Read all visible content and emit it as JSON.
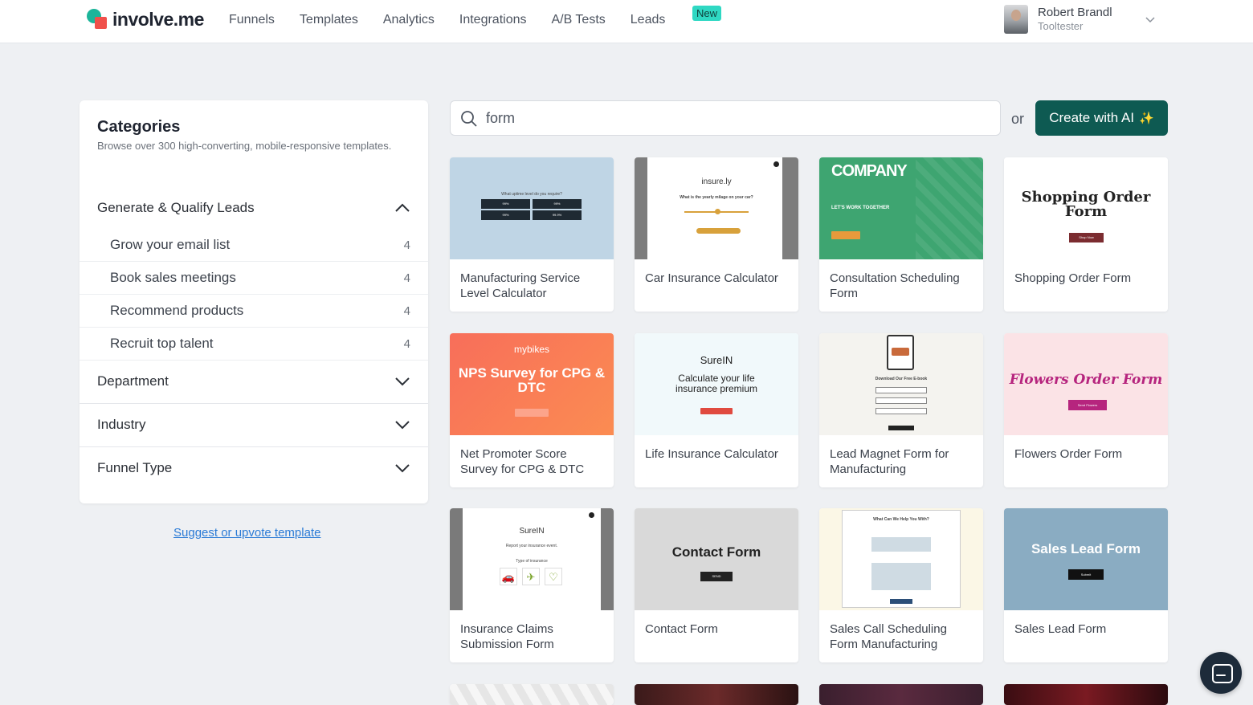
{
  "app": {
    "logo_text": "involve.me",
    "nav": [
      "Funnels",
      "Templates",
      "Analytics",
      "Integrations",
      "A/B Tests",
      "Leads"
    ],
    "new_badge": "New",
    "user": {
      "name": "Robert Brandl",
      "org": "Tooltester"
    }
  },
  "sidebar": {
    "title": "Categories",
    "description": "Browse over 300 high-converting, mobile-responsive templates.",
    "expanded_section": "Generate & Qualify Leads",
    "items": [
      {
        "label": "Grow your email list",
        "count": "4"
      },
      {
        "label": "Book sales meetings",
        "count": "4"
      },
      {
        "label": "Recommend products",
        "count": "4"
      },
      {
        "label": "Recruit top talent",
        "count": "4"
      }
    ],
    "collapsed_sections": [
      "Department",
      "Industry",
      "Funnel Type"
    ],
    "suggest_link": "Suggest or upvote template"
  },
  "search": {
    "value": "form",
    "or": "or",
    "ai_button": "Create with AI",
    "ai_sparkle": "✨"
  },
  "templates": [
    {
      "title": "Manufacturing Service Level Calculator",
      "thumb_text": "What uptime level do you require?",
      "thumb_buttons": [
        "99%",
        "99%",
        "99%",
        "99.9%"
      ]
    },
    {
      "title": "Car Insurance Calculator",
      "thumb_logo": "insure.ly",
      "thumb_text": "What is the yearly milage on your car?"
    },
    {
      "title": "Consultation Scheduling Form",
      "thumb_logo": "COMPANY",
      "thumb_text": "LET'S WORK TOGETHER"
    },
    {
      "title": "Shopping Order Form",
      "thumb_title": "Shopping Order Form",
      "thumb_button": "Shop Now"
    },
    {
      "title": "Net Promoter Score Survey for CPG & DTC",
      "thumb_logo": "mybikes",
      "thumb_title": "NPS Survey for CPG & DTC"
    },
    {
      "title": "Life Insurance Calculator",
      "thumb_logo": "SureIN",
      "thumb_title": "Calculate your life insurance premium"
    },
    {
      "title": "Lead Magnet Form for Manufacturing",
      "thumb_text": "Download Our Free E-book"
    },
    {
      "title": "Flowers Order Form",
      "thumb_title": "Flowers Order Form",
      "thumb_button": "Send Flowers"
    },
    {
      "title": "Insurance Claims Submission Form",
      "thumb_logo": "SureIN",
      "thumb_text": "Report your insurance event.",
      "thumb_sub": "Type of insurance"
    },
    {
      "title": "Contact Form",
      "thumb_title": "Contact Form",
      "thumb_button": "SEND"
    },
    {
      "title": "Sales Call Scheduling Form Manufacturing",
      "thumb_text": "What Can We Help You With?"
    },
    {
      "title": "Sales Lead Form",
      "thumb_title": "Sales Lead Form",
      "thumb_button": "Submit"
    }
  ],
  "colors": {
    "accent": "#0e5a52",
    "new_badge": "#2fd8c3",
    "link": "#2b7bd6"
  }
}
